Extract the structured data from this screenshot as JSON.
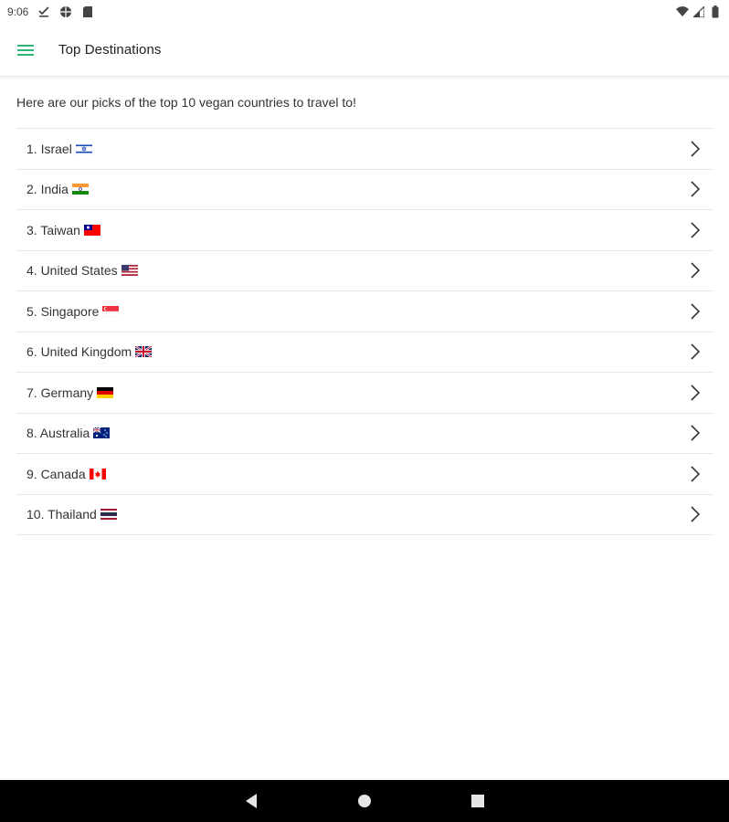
{
  "status_bar": {
    "time": "9:06"
  },
  "app_bar": {
    "title": "Top Destinations",
    "menu_icon": "hamburger-menu-icon",
    "accent_color": "#2BB673"
  },
  "content": {
    "intro": "Here are our picks of the top 10 vegan countries to travel to!",
    "items": [
      {
        "label": "1. Israel",
        "flag": "israel"
      },
      {
        "label": "2. India",
        "flag": "india"
      },
      {
        "label": "3. Taiwan",
        "flag": "taiwan"
      },
      {
        "label": "4. United States",
        "flag": "united-states"
      },
      {
        "label": "5. Singapore",
        "flag": "singapore"
      },
      {
        "label": "6. United Kingdom",
        "flag": "united-kingdom"
      },
      {
        "label": "7. Germany",
        "flag": "germany"
      },
      {
        "label": "8. Australia",
        "flag": "australia"
      },
      {
        "label": "9. Canada",
        "flag": "canada"
      },
      {
        "label": "10. Thailand",
        "flag": "thailand"
      }
    ]
  },
  "nav_bar": {
    "back_icon": "back-triangle-icon",
    "home_icon": "home-circle-icon",
    "recents_icon": "recents-square-icon"
  }
}
